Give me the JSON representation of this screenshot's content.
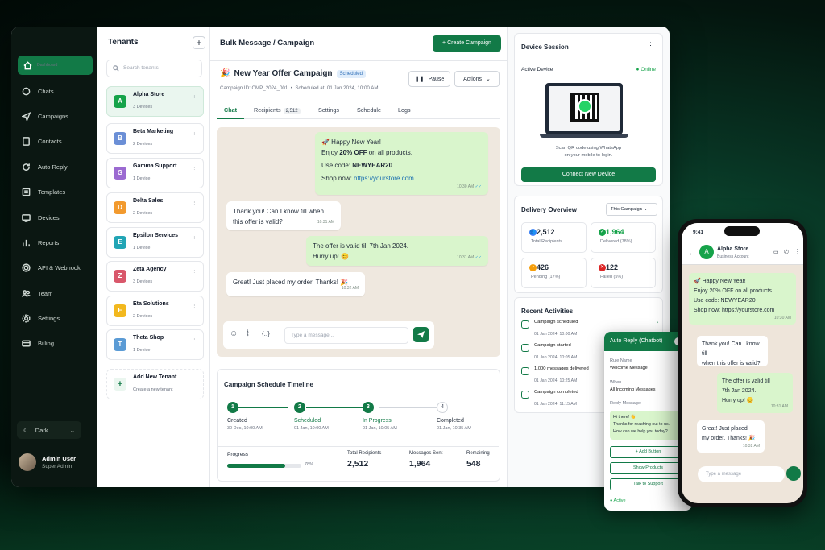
{
  "sidebar": {
    "items": [
      {
        "label": "Dashboard"
      },
      {
        "label": "Chats"
      },
      {
        "label": "Campaigns"
      },
      {
        "label": "Contacts"
      },
      {
        "label": "Auto Reply"
      },
      {
        "label": "Templates"
      },
      {
        "label": "Devices"
      },
      {
        "label": "Reports"
      },
      {
        "label": "API & Webhook"
      },
      {
        "label": "Team"
      },
      {
        "label": "Settings"
      },
      {
        "label": "Billing"
      }
    ],
    "theme": "Dark",
    "user": {
      "name": "Admin User",
      "role": "Super Admin"
    }
  },
  "tenants": {
    "title": "Tenants",
    "search_placeholder": "Search tenants",
    "items": [
      {
        "name": "Alpha Store",
        "devices": "3 Devices",
        "letter": "A",
        "color": "#16a34a"
      },
      {
        "name": "Beta Marketing",
        "devices": "2 Devices",
        "letter": "B",
        "color": "#6b8fd6"
      },
      {
        "name": "Gamma Support",
        "devices": "1 Device",
        "letter": "G",
        "color": "#9b6ad1"
      },
      {
        "name": "Delta Sales",
        "devices": "2 Devices",
        "letter": "D",
        "color": "#f29a2e"
      },
      {
        "name": "Epsilon Services",
        "devices": "1 Device",
        "letter": "E",
        "color": "#22a5b5"
      },
      {
        "name": "Zeta Agency",
        "devices": "3 Devices",
        "letter": "Z",
        "color": "#d9576b"
      },
      {
        "name": "Eta Solutions",
        "devices": "2 Devices",
        "letter": "E",
        "color": "#f2b81e"
      },
      {
        "name": "Theta Shop",
        "devices": "1 Device",
        "letter": "T",
        "color": "#5b9bd5"
      }
    ],
    "add": {
      "label": "Add New Tenant",
      "sub": "Create a new tenant"
    }
  },
  "main": {
    "breadcrumb": "Bulk Message / Campaign",
    "create_label": "+ Create Campaign",
    "campaign": {
      "emoji": "🎉",
      "title": "New Year Offer Campaign",
      "status": "Scheduled",
      "id": "Campaign ID: CMP_2024_001",
      "scheduled": "Scheduled at: 01 Jan 2024, 10:00 AM"
    },
    "pause_label": "Pause",
    "actions_label": "Actions",
    "tabs": [
      "Chat",
      "Recipients",
      "Settings",
      "Schedule",
      "Logs"
    ],
    "recipients_count": "2,512"
  },
  "chat": {
    "messages": [
      {
        "l1": "🚀 Happy New Year!",
        "l2a": "Enjoy ",
        "l2b": "20% OFF",
        "l2c": " on all products.",
        "l3a": "Use code: ",
        "l3b": "NEWYEAR20",
        "l4a": "Shop now: ",
        "l4b": "https://yourstore.com",
        "time": "10:30 AM"
      },
      {
        "text1": "Thank you! Can I know till when",
        "text2": "this offer is valid?",
        "time": "10:31 AM"
      },
      {
        "text1": "The offer is valid till 7th Jan 2024.",
        "text2": "Hurry up! 😊",
        "time": "10:31 AM"
      },
      {
        "text": "Great! Just placed my order. Thanks! 🎉",
        "time": "10:32 AM"
      }
    ],
    "placeholder": "Type a message..."
  },
  "schedule": {
    "title": "Campaign Schedule Timeline",
    "steps": [
      {
        "n": "1",
        "label": "Created",
        "date": "30 Dec, 10:00 AM"
      },
      {
        "n": "2",
        "label": "Scheduled",
        "date": "01 Jan, 10:00 AM"
      },
      {
        "n": "3",
        "label": "In Progress",
        "date": "01 Jan, 10:05 AM"
      },
      {
        "n": "4",
        "label": "Completed",
        "date": "01 Jan, 10:35 AM"
      }
    ],
    "progress_label": "Progress",
    "progress": 0.78,
    "progress_text": "78%",
    "stats": [
      {
        "label": "Total Recipients",
        "value": "2,512"
      },
      {
        "label": "Messages Sent",
        "value": "1,964"
      },
      {
        "label": "Remaining",
        "value": "548"
      }
    ]
  },
  "device": {
    "title": "Device Session",
    "active_label": "Active Device",
    "status": "Online",
    "scan1": "Scan QR code using WhatsApp",
    "scan2": "on your mobile to login.",
    "connect_label": "Connect New Device"
  },
  "delivery": {
    "title": "Delivery Overview",
    "filter": "This Campaign",
    "cards": [
      {
        "value": "2,512",
        "label": "Total Recipients",
        "color": "#3b82f6",
        "icon": "👥"
      },
      {
        "value": "1,964",
        "label": "Delivered (78%)",
        "color": "#16a34a",
        "icon": "✓"
      },
      {
        "value": "426",
        "label": "Pending (17%)",
        "color": "#f59e0b",
        "icon": "◔"
      },
      {
        "value": "122",
        "label": "Failed (5%)",
        "color": "#dc2626",
        "icon": "✕"
      }
    ]
  },
  "activities": {
    "title": "Recent Activities",
    "items": [
      {
        "text": "Campaign scheduled",
        "time": "01 Jan 2024, 10:00 AM"
      },
      {
        "text": "Campaign started",
        "time": "01 Jan 2024, 10:05 AM"
      },
      {
        "text": "1,000 messages delivered",
        "time": "01 Jan 2024, 10:25 AM"
      },
      {
        "text": "Campaign completed",
        "time": "01 Jan 2024, 11:15 AM"
      }
    ]
  },
  "autoreply": {
    "title": "Auto Reply (Chatbot)",
    "rule_label": "Rule Name",
    "rule": "Welcome Message",
    "when_label": "When",
    "when": "All Incoming Messages",
    "reply_label": "Reply Message",
    "reply1": "Hi there! 👋",
    "reply2": "Thanks for reaching out to us.",
    "reply3": "How can we help you today?",
    "buttons": [
      "+ Add Button",
      "Show Products",
      "Talk to Support"
    ],
    "status": "Active"
  },
  "phone": {
    "time": "9:41",
    "name": "Alpha Store",
    "sub": "Business Account",
    "placeholder": "Type a message",
    "messages": [
      {
        "l1": "🚀 Happy New Year!",
        "l2": "Enjoy 20% OFF on all products.",
        "l3": "Use code: NEWYEAR20",
        "l4": "Shop now: https://yourstore.com",
        "time": "10:30 AM"
      },
      {
        "l1": "Thank you! Can I know till",
        "l2": "when this offer is valid?",
        "time": "10:31 AM"
      },
      {
        "l1": "The offer is valid till",
        "l2": "7th Jan 2024.",
        "l3": "Hurry up! 😊",
        "time": "10:31 AM"
      },
      {
        "l1": "Great! Just placed",
        "l2": "my order. Thanks! 🎉",
        "time": "10:32 AM"
      }
    ]
  }
}
